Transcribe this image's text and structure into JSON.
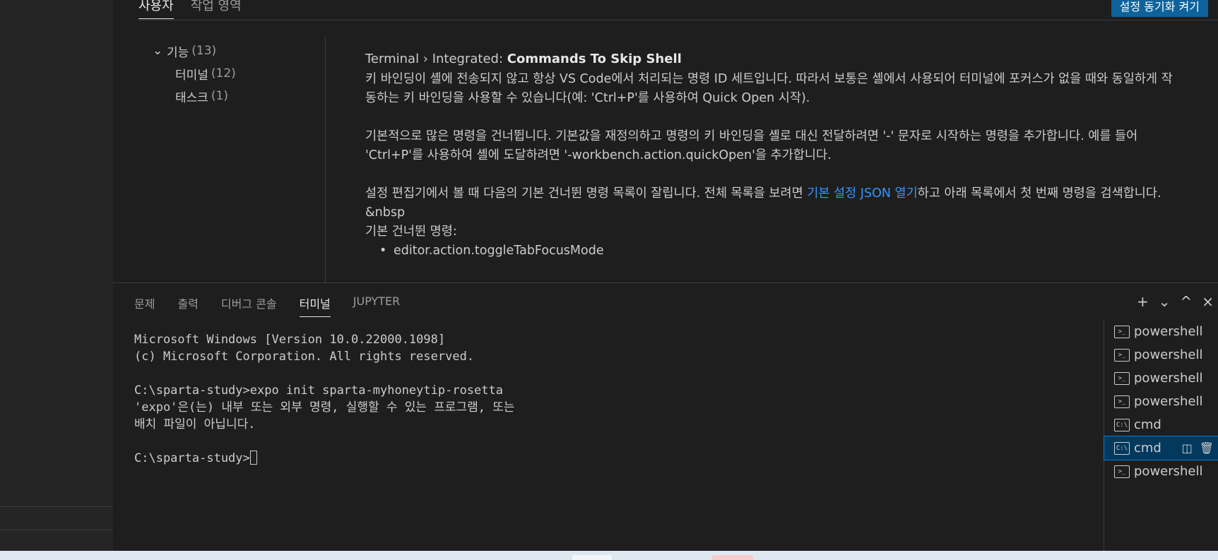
{
  "settings": {
    "scope_tabs": [
      "사용자",
      "작업 영역"
    ],
    "sync_button": "설정 동기화 켜기",
    "toc": [
      {
        "label": "기능",
        "count": "(13)"
      },
      {
        "label": "터미널",
        "count": "(12)"
      },
      {
        "label": "태스크",
        "count": "(1)"
      }
    ],
    "title_prefix": "Terminal › Integrated: ",
    "title_name": "Commands To Skip Shell",
    "para1": "키 바인딩이 셸에 전송되지 않고 항상 VS Code에서 처리되는 명령 ID 세트입니다. 따라서 보통은 셸에서 사용되어 터미널에 포커스가 없을 때와 동일하게 작동하는 키 바인딩을 사용할 수 있습니다(예: 'Ctrl+P'를 사용하여 Quick Open 시작).",
    "para2": "기본적으로 많은 명령을 건너뜁니다. 기본값을 재정의하고 명령의 키 바인딩을 셸로 대신 전달하려면 '-' 문자로 시작하는 명령을 추가합니다. 예를 들어 'Ctrl+P'를 사용하여 셸에 도달하려면 '-workbench.action.quickOpen'을 추가합니다.",
    "para3_before": "설정 편집기에서 볼 때 다음의 기본 건너뛴 명령 목록이 잘립니다. 전체 목록을 보려면 ",
    "para3_link": "기본 설정 JSON 열기",
    "para3_after": "하고 아래 목록에서 첫 번째 명령을 검색합니다.",
    "nbsp_text": "&nbsp",
    "default_label": "기본 건너뛴 명령:",
    "commands": [
      "editor.action.toggleTabFocusMode"
    ]
  },
  "panel": {
    "tabs": [
      "문제",
      "출력",
      "디버그 콘솔",
      "터미널",
      "JUPYTER"
    ],
    "active_tab": "터미널",
    "actions": {
      "add": "+",
      "dropdown": "⌄",
      "maximize": "^",
      "close": "×"
    }
  },
  "terminal": {
    "line1": "Microsoft Windows [Version 10.0.22000.1098]",
    "line2": "(c) Microsoft Corporation. All rights reserved.",
    "line3": "",
    "line4": "C:\\sparta-study>expo init sparta-myhoneytip-rosetta",
    "line5": "'expo'은(는) 내부 또는 외부 명령, 실행할 수 있는 프로그램, 또는",
    "line6": "배치 파일이 아닙니다.",
    "line7": "",
    "prompt": "C:\\sparta-study>"
  },
  "terminal_list": [
    {
      "name": "powershell",
      "icon": "powershell-icon"
    },
    {
      "name": "powershell",
      "icon": "powershell-icon"
    },
    {
      "name": "powershell",
      "icon": "powershell-icon"
    },
    {
      "name": "powershell",
      "icon": "powershell-icon"
    },
    {
      "name": "cmd",
      "icon": "cmd-icon"
    },
    {
      "name": "cmd",
      "icon": "cmd-icon",
      "selected": true
    },
    {
      "name": "powershell",
      "icon": "powershell-icon"
    }
  ],
  "colors": {
    "background": "#1e1e1e",
    "link": "#3794ff",
    "selection": "#04395e",
    "focus_border": "#007fd4",
    "button": "#0e639c"
  }
}
